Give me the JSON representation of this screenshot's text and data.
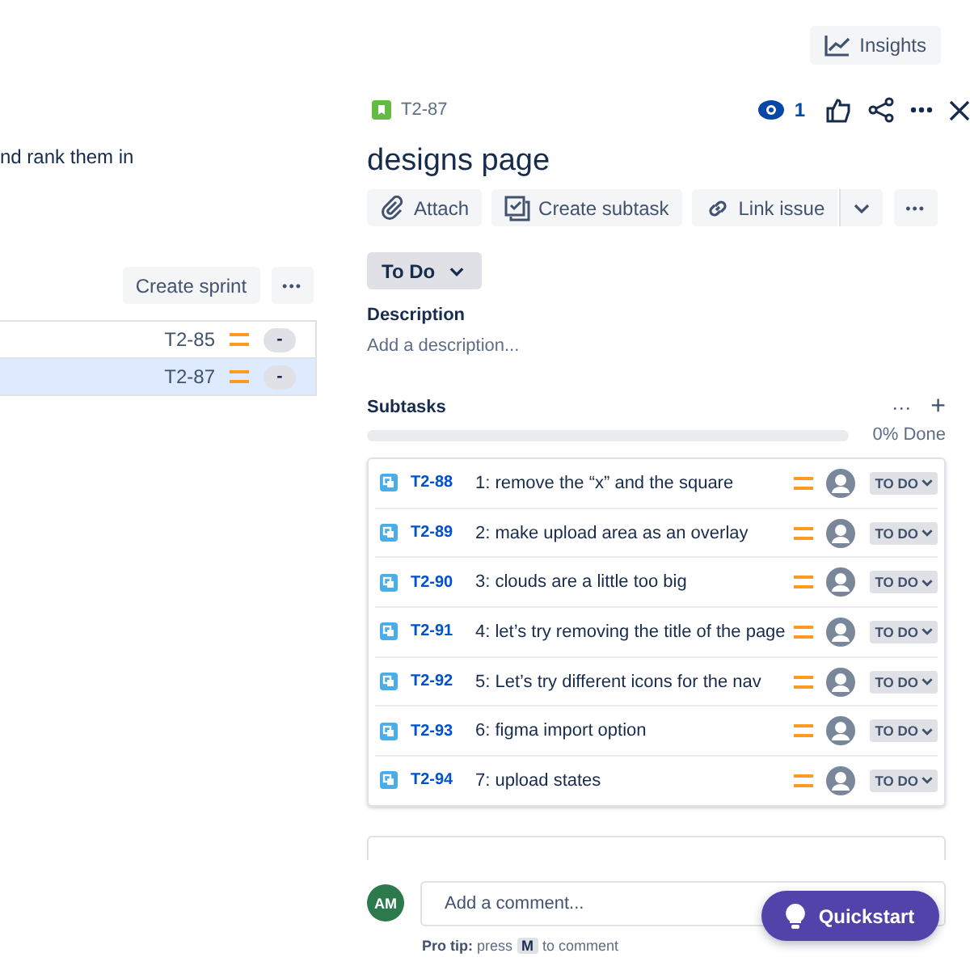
{
  "top_bar": {
    "insights_label": "Insights"
  },
  "backlog": {
    "description_fragment": "nd rank them in",
    "create_sprint_label": "Create sprint",
    "more_label": "•••",
    "rows": [
      {
        "key": "T2-85",
        "estimate": "-",
        "selected": false
      },
      {
        "key": "T2-87",
        "estimate": "-",
        "selected": true
      }
    ]
  },
  "issue": {
    "key": "T2-87",
    "watchers": "1",
    "title": "designs page",
    "actions": [
      {
        "kind": "attach",
        "label": "Attach"
      },
      {
        "kind": "subtask",
        "label": "Create subtask"
      },
      {
        "kind": "link",
        "label": "Link issue"
      }
    ],
    "more_label": "•••",
    "status": "To Do",
    "description_heading": "Description",
    "description_placeholder": "Add a description...",
    "subtasks_heading": "Subtasks",
    "subtasks_more": "···",
    "subtasks_add": "+",
    "progress": {
      "level": 0,
      "reading": "0% Done"
    },
    "subtasks": [
      {
        "key": "T2-88",
        "title": "1: remove the “x” and the square",
        "status": "TO DO"
      },
      {
        "key": "T2-89",
        "title": "2: make upload area as an overlay",
        "status": "TO DO"
      },
      {
        "key": "T2-90",
        "title": "3: clouds are a little too big",
        "status": "TO DO"
      },
      {
        "key": "T2-91",
        "title": "4: let’s try removing the title of the page",
        "status": "TO DO"
      },
      {
        "key": "T2-92",
        "title": "5: Let’s try different icons for the nav",
        "status": "TO DO"
      },
      {
        "key": "T2-93",
        "title": "6: figma import option",
        "status": "TO DO"
      },
      {
        "key": "T2-94",
        "title": "7: upload states",
        "status": "TO DO"
      }
    ],
    "comment": {
      "avatar_initials": "AM",
      "placeholder": "Add a comment...",
      "pro_tip_label": "Pro tip:",
      "pro_tip_before": "press",
      "pro_tip_key": "M",
      "pro_tip_after": "to comment"
    }
  },
  "quickstart": {
    "label": "Quickstart"
  }
}
